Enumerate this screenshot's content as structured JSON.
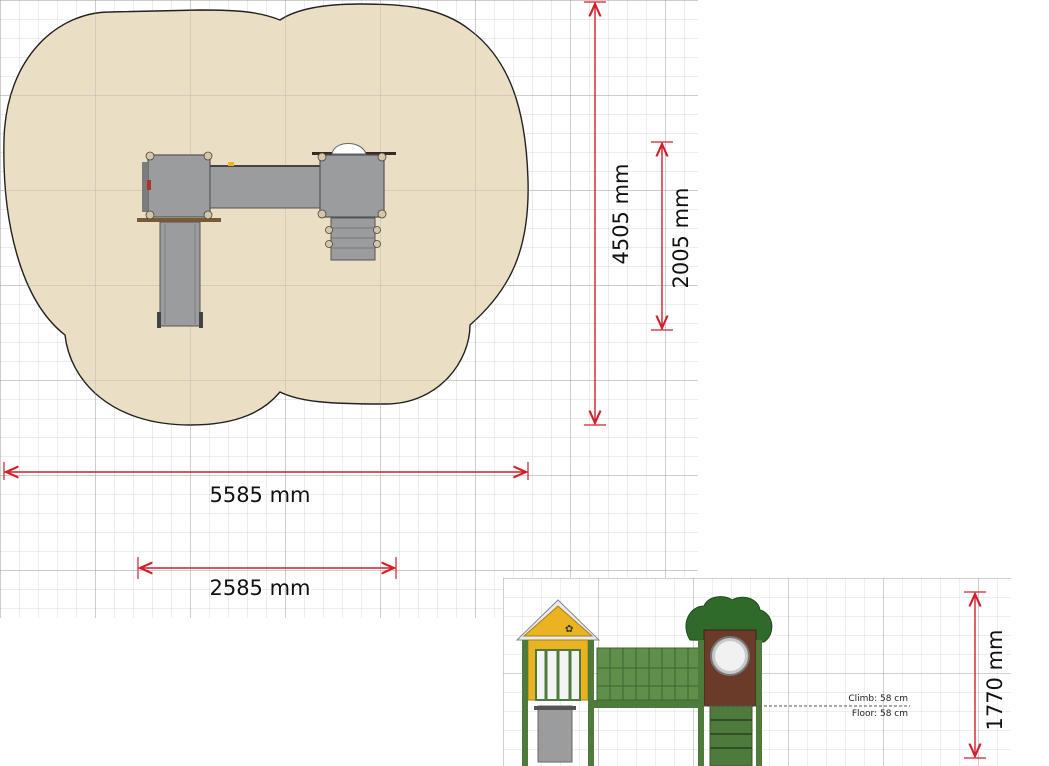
{
  "dimensions": {
    "overall_width": "5585 mm",
    "structure_width": "2585 mm",
    "overall_depth": "4505 mm",
    "structure_depth": "2005 mm",
    "height": "1770 mm"
  },
  "notes": {
    "climb": "Climb: 58 cm",
    "floor": "Floor: 58 cm"
  },
  "colors": {
    "dimension_line": "#d21e2a",
    "safety_zone": "#eadfc4",
    "platform_grey": "#9a9c9e",
    "frame_green": "#4e7a3c",
    "roof_yellow": "#e9b321",
    "tree_brown": "#6b3b2a"
  }
}
